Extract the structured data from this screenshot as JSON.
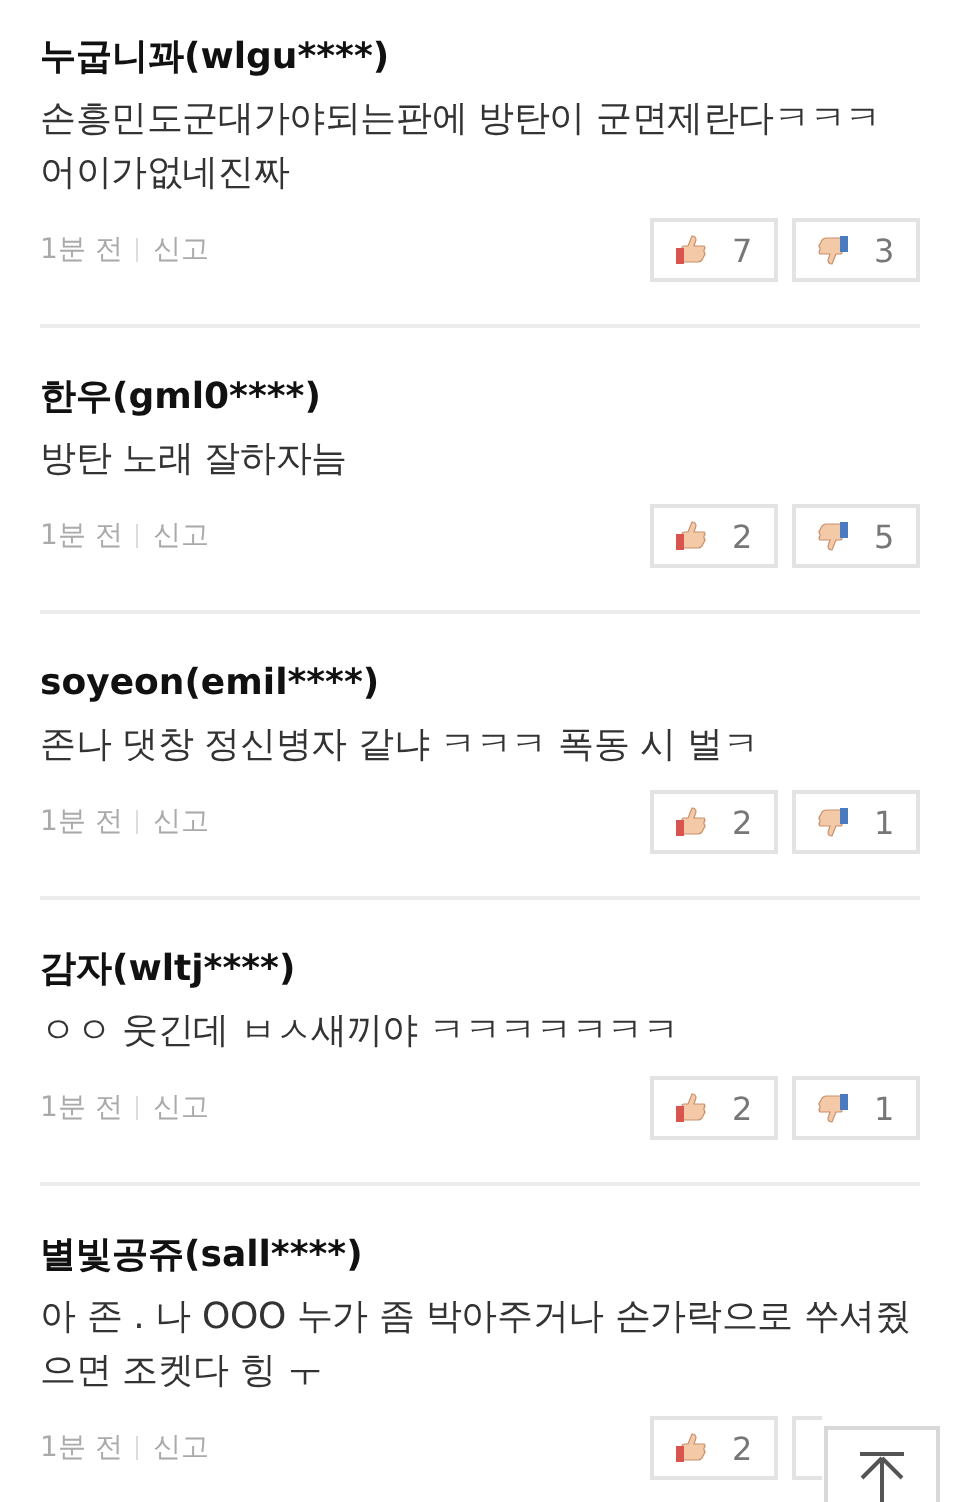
{
  "comments": [
    {
      "author": "누굽니꽈(wlgu****)",
      "body": "손흥민도군대가야되는판에 방탄이 군면제란다ㅋㅋㅋ 어이가없네진짜",
      "time": "1분 전",
      "report": "신고",
      "likes": "7",
      "dislikes": "3"
    },
    {
      "author": "한우(gml0****)",
      "body": "방탄 노래 잘하자늠",
      "time": "1분 전",
      "report": "신고",
      "likes": "2",
      "dislikes": "5"
    },
    {
      "author": "soyeon(emil****)",
      "body": "존나 댓창 정신병자 같냐 ㅋㅋㅋ 폭동 시 벌ㅋ",
      "time": "1분 전",
      "report": "신고",
      "likes": "2",
      "dislikes": "1"
    },
    {
      "author": "감자(wltj****)",
      "body": "ㅇㅇ 웃긴데 ㅂㅅ새끼야 ㅋㅋㅋㅋㅋㅋㅋ",
      "time": "1분 전",
      "report": "신고",
      "likes": "2",
      "dislikes": "1"
    },
    {
      "author": "별빛공쥬(sall****)",
      "body": "아 존 . 나 OOO 누가 좀 박아주거나 손가락으로 쑤셔줬으면 조켓다 힝 ㅜ",
      "time": "1분 전",
      "report": "신고",
      "likes": "2"
    }
  ]
}
